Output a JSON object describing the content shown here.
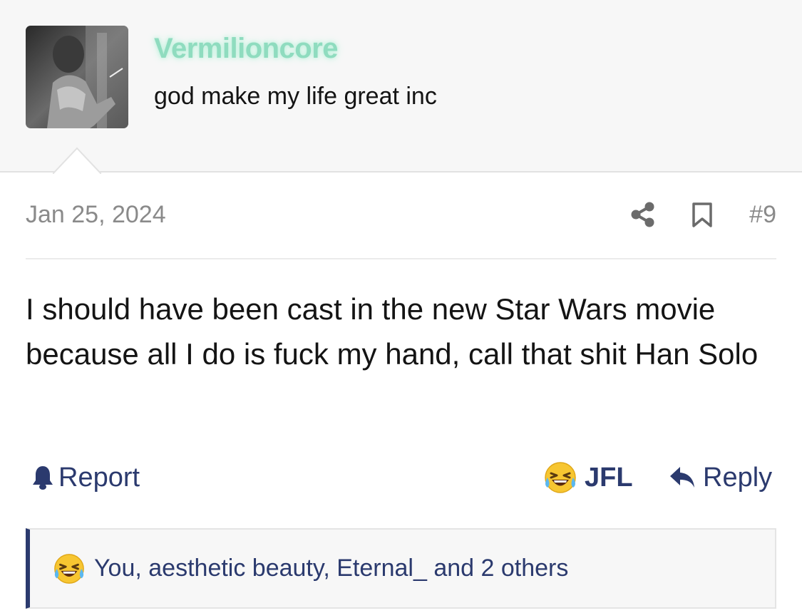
{
  "user": {
    "username": "Vermilioncore",
    "username_color": "#8fdcbf",
    "title": "god make my life great inc"
  },
  "post": {
    "date": "Jan 25, 2024",
    "number": "#9",
    "body": "I should have been cast in the new Star Wars movie because all I do is fuck my hand, call that shit Han Solo"
  },
  "actions": {
    "report_label": "Report",
    "reaction_label": "JFL",
    "reply_label": "Reply"
  },
  "reactions": {
    "summary": "You, aesthetic beauty, Eternal_ and 2 others"
  },
  "icons": [
    "share-icon",
    "bookmark-icon",
    "bell-icon",
    "laughing-crying-emoji-icon",
    "reply-arrow-icon"
  ],
  "colors": {
    "link": "#2b3a6e",
    "meta_gray": "#8a8a8a",
    "header_bg": "#f7f7f7",
    "accent_bar": "#2b3a6e"
  }
}
